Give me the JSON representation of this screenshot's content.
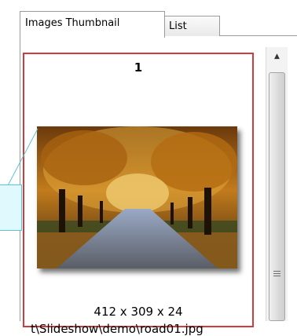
{
  "tabs": [
    {
      "label": "Images Thumbnail",
      "active": true
    },
    {
      "label": "List",
      "active": false
    }
  ],
  "thumbnail": {
    "index": "1",
    "dimensions": "412 x 309 x 24",
    "path": "t\\Slideshow\\demo\\road01.jpg",
    "selected_border_color": "#d23b3b"
  },
  "icons": {
    "scroll_up": "triangle-up-icon",
    "scroll_grip": "grip-lines-icon"
  }
}
